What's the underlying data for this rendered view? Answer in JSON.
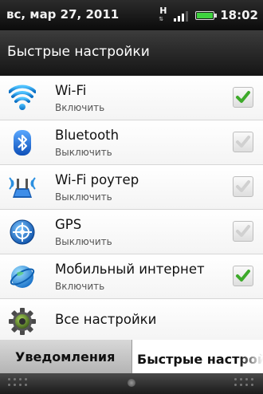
{
  "status_bar": {
    "date": "вс, мар 27, 2011",
    "time": "18:02",
    "network_type": "H",
    "icons": [
      "hsdpa-data-icon",
      "signal-strength-icon",
      "battery-icon"
    ],
    "battery_color": "#3fd23f"
  },
  "header": {
    "title": "Быстрые настройки"
  },
  "settings": [
    {
      "title": "Wi-Fi",
      "subtitle": "Включить",
      "icon": "wifi-icon",
      "checked": true
    },
    {
      "title": "Bluetooth",
      "subtitle": "Выключить",
      "icon": "bluetooth-icon",
      "checked": false
    },
    {
      "title": "Wi-Fi роутер",
      "subtitle": "Выключить",
      "icon": "wifi-router-icon",
      "checked": false
    },
    {
      "title": "GPS",
      "subtitle": "Выключить",
      "icon": "gps-icon",
      "checked": false
    },
    {
      "title": "Мобильный интернет",
      "subtitle": "Включить",
      "icon": "mobile-internet-icon",
      "checked": true
    },
    {
      "title": "Все настройки",
      "icon": "settings-gear-icon"
    }
  ],
  "tabs": [
    {
      "label": "Уведомления",
      "active": false
    },
    {
      "label": "Быстрые настройки",
      "active": true
    }
  ],
  "colors": {
    "check_green": "#3daa2a",
    "check_disabled": "#d0d0d0"
  }
}
